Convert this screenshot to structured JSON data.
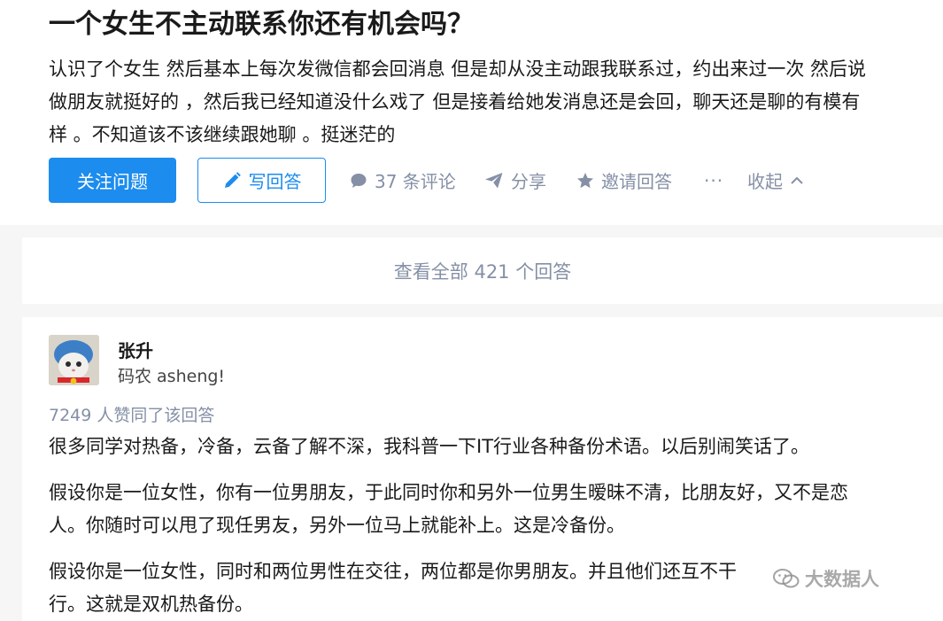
{
  "question": {
    "title": "一个女生不主动联系你还有机会吗？",
    "detail_lines": [
      "认识了个女生 然后基本上每次发微信都会回消息 但是却从没主动跟我联系过，约出来过一次 然后说",
      "做朋友就挺好的 ，然后我已经知道没什么戏了 但是接着给她发消息还是会回，聊天还是聊的有模有",
      "样 。不知道该不该继续跟她聊 。挺迷茫的"
    ]
  },
  "actions": {
    "follow_label": "关注问题",
    "write_label": "写回答",
    "comments_label": "37 条评论",
    "share_label": "分享",
    "invite_label": "邀请回答",
    "more_label": "···",
    "collapse_label": "收起"
  },
  "view_all_label": "查看全部 421 个回答",
  "answer": {
    "author_name": "张升",
    "author_bio": "码农 asheng!",
    "votes_text": "7249 人赞同了该回答",
    "paragraphs": [
      [
        "很多同学对热备，冷备，云备了解不深，我科普一下IT行业各种备份术语。以后别闹笑话了。"
      ],
      [
        "假设你是一位女性，你有一位男朋友，于此同时你和另外一位男生暧昧不清，比朋友好，又不是恋",
        "人。你随时可以甩了现任男友，另外一位马上就能补上。这是冷备份。"
      ],
      [
        "假设你是一位女性，同时和两位男性在交往，两位都是你男朋友。并且他们还互不干",
        "行。这就是双机热备份。"
      ]
    ]
  },
  "watermark": {
    "text": "大数据人",
    "icon": "wechat-icon"
  },
  "colors": {
    "primary": "#1c8cee",
    "muted": "#8590a6",
    "background": "#f6f6f6"
  }
}
